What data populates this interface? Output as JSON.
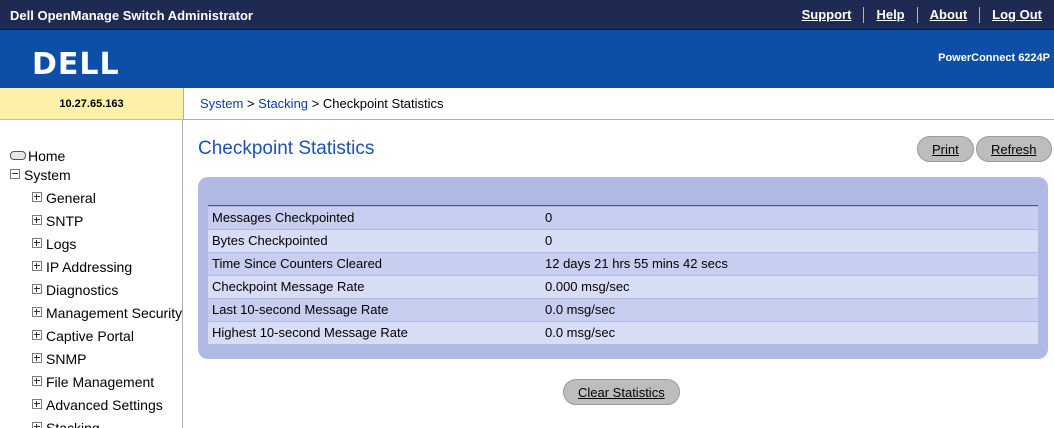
{
  "header": {
    "app_title": "Dell OpenManage Switch Administrator",
    "nav": [
      "Support",
      "Help",
      "About",
      "Log Out"
    ],
    "logo": "DELL",
    "product": "PowerConnect 6224P"
  },
  "ip_address": "10.27.65.163",
  "breadcrumb": {
    "system": "System",
    "stacking": "Stacking",
    "current": "Checkpoint Statistics",
    "sep": " > "
  },
  "sidebar": {
    "home": "Home",
    "system": "System",
    "items": [
      "General",
      "SNTP",
      "Logs",
      "IP Addressing",
      "Diagnostics",
      "Management Security",
      "Captive Portal",
      "SNMP",
      "File Management",
      "Advanced Settings",
      "Stacking"
    ]
  },
  "page": {
    "title": "Checkpoint Statistics",
    "print_label": "Print",
    "refresh_label": "Refresh",
    "clear_label": "Clear Statistics"
  },
  "stats": [
    {
      "label": "Messages Checkpointed",
      "value": "0"
    },
    {
      "label": "Bytes Checkpointed",
      "value": "0"
    },
    {
      "label": "Time Since Counters Cleared",
      "value": "12 days 21 hrs 55 mins 42 secs"
    },
    {
      "label": "Checkpoint Message Rate",
      "value": "0.000 msg/sec"
    },
    {
      "label": "Last 10-second Message Rate",
      "value": "0.0 msg/sec"
    },
    {
      "label": "Highest 10-second Message Rate",
      "value": "0.0 msg/sec"
    }
  ],
  "colors": {
    "topbar": "#1f2a52",
    "brand": "#0d4fa6",
    "ip_bg": "#fdf0a8",
    "title": "#1d50b8",
    "panel": "#b0b8e4"
  }
}
